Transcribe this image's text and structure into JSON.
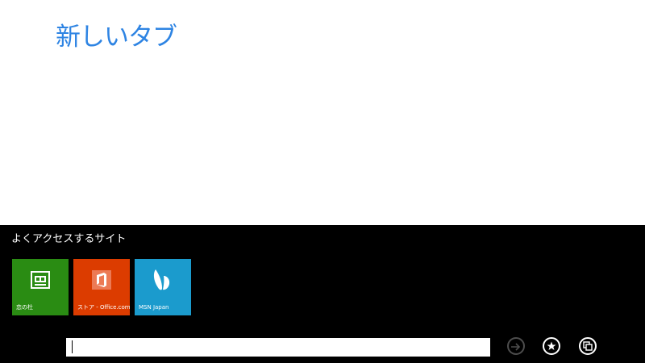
{
  "page": {
    "title": "新しいタブ",
    "title_color": "#2e84e3"
  },
  "frequent": {
    "heading": "よくアクセスするサイト",
    "tiles": [
      {
        "label": "恋の杜",
        "color": "#2a8c13",
        "icon": "bookmark-card-icon"
      },
      {
        "label": "ストア - Office.com",
        "color": "#dc3c00",
        "icon": "office-logo-icon"
      },
      {
        "label": "MSN Japan",
        "color": "#1b9bcd",
        "icon": "msn-butterfly-icon"
      }
    ]
  },
  "address_bar": {
    "value": "",
    "placeholder": ""
  },
  "buttons": {
    "go": {
      "icon": "arrow-right-icon",
      "state": "disabled"
    },
    "favorites": {
      "icon": "star-icon"
    },
    "tabs": {
      "icon": "tabs-icon"
    }
  }
}
